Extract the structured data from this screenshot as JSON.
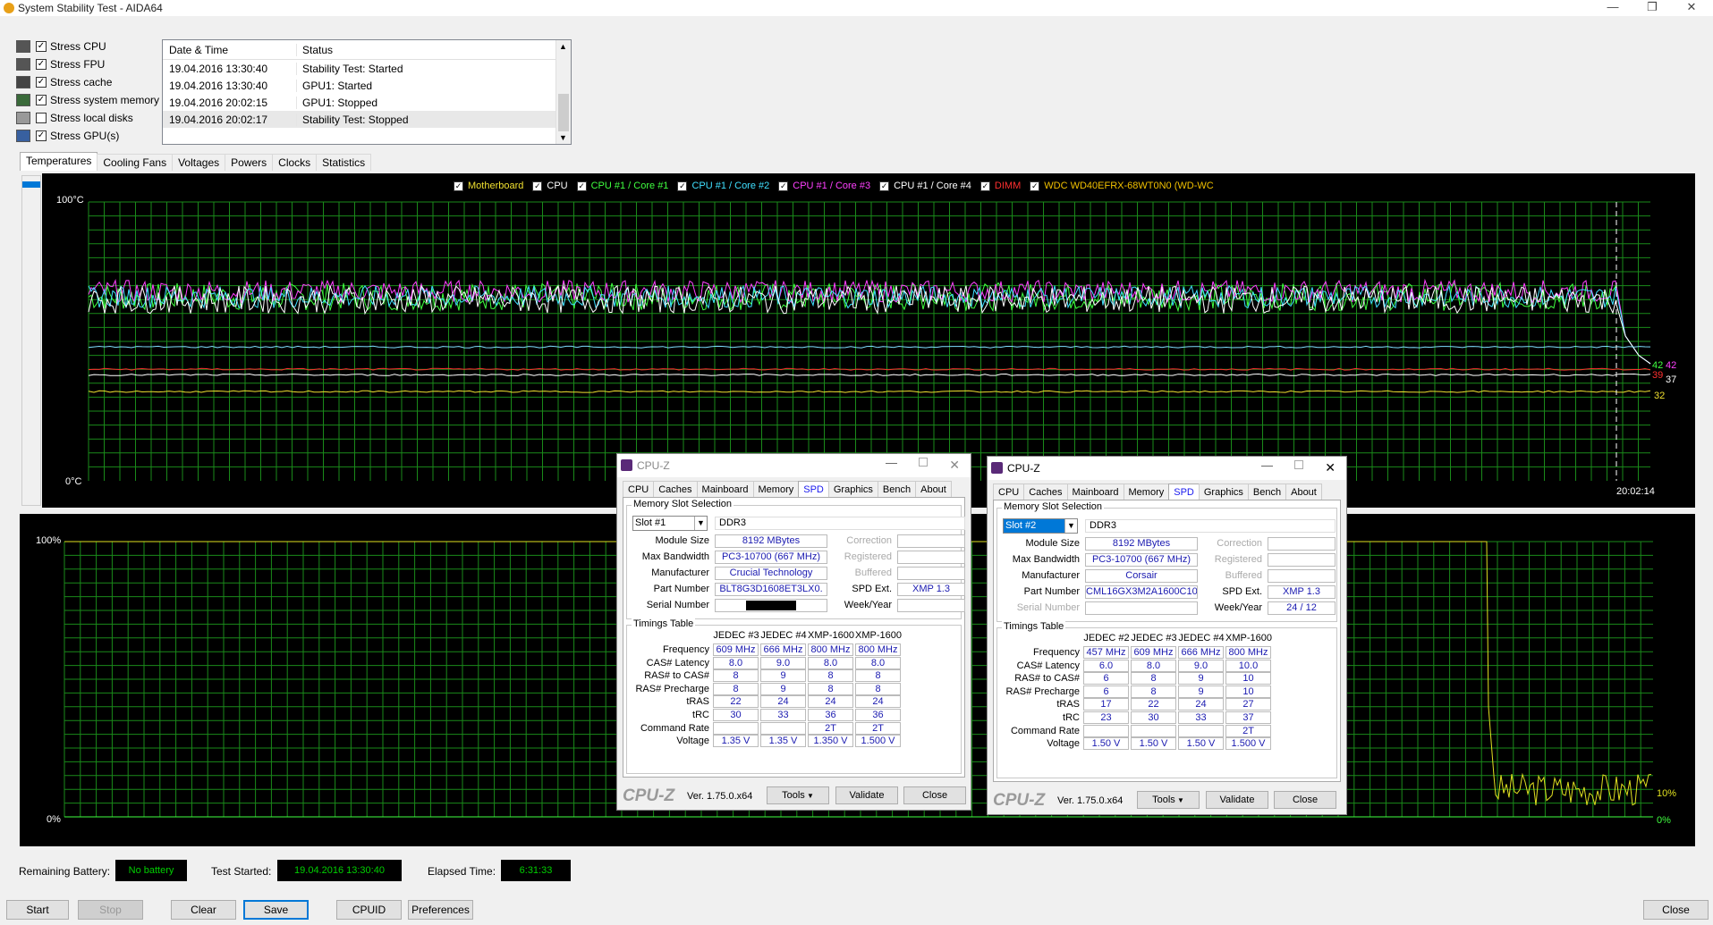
{
  "window": {
    "title": "System Stability Test - AIDA64",
    "minimize": "—",
    "restore": "❐",
    "close": "✕"
  },
  "stress_options": [
    {
      "label": "Stress CPU",
      "checked": true
    },
    {
      "label": "Stress FPU",
      "checked": true
    },
    {
      "label": "Stress cache",
      "checked": true
    },
    {
      "label": "Stress system memory",
      "checked": true
    },
    {
      "label": "Stress local disks",
      "checked": false
    },
    {
      "label": "Stress GPU(s)",
      "checked": true
    }
  ],
  "log": {
    "headers": [
      "Date & Time",
      "Status"
    ],
    "rows": [
      [
        "19.04.2016 13:30:40",
        "Stability Test: Started"
      ],
      [
        "19.04.2016 13:30:40",
        "GPU1: Started"
      ],
      [
        "19.04.2016 20:02:15",
        "GPU1: Stopped"
      ],
      [
        "19.04.2016 20:02:17",
        "Stability Test: Stopped"
      ]
    ]
  },
  "tabs": [
    "Temperatures",
    "Cooling Fans",
    "Voltages",
    "Powers",
    "Clocks",
    "Statistics"
  ],
  "active_tab": "Temperatures",
  "temp_graph": {
    "y_max": "100°C",
    "y_min": "0°C",
    "time": "20:02:14",
    "legend": [
      {
        "label": "Motherboard",
        "color": "#f0e030"
      },
      {
        "label": "CPU",
        "color": "#ffffff"
      },
      {
        "label": "CPU #1 / Core #1",
        "color": "#40ff40"
      },
      {
        "label": "CPU #1 / Core #2",
        "color": "#40e0ff"
      },
      {
        "label": "CPU #1 / Core #3",
        "color": "#ff40ff"
      },
      {
        "label": "CPU #1 / Core #4",
        "color": "#ffffff"
      },
      {
        "label": "DIMM",
        "color": "#ff3030"
      },
      {
        "label": "WDC WD40EFRX-68WT0N0 (WD-WC",
        "color": "#f0c000"
      }
    ],
    "end_values": [
      {
        "text": "42",
        "color": "#40ff40"
      },
      {
        "text": "42",
        "color": "#ff40ff"
      },
      {
        "text": "39",
        "color": "#ff3030"
      },
      {
        "text": "37",
        "color": "#ffffff"
      },
      {
        "text": "32",
        "color": "#f0e030"
      }
    ]
  },
  "usage_graph": {
    "y_max": "100%",
    "y_min": "0%",
    "end_value_cpu": "10%",
    "end_value_throttle": "0%"
  },
  "cpuz_windows": [
    {
      "title": "CPU-Z",
      "tabs": [
        "CPU",
        "Caches",
        "Mainboard",
        "Memory",
        "SPD",
        "Graphics",
        "Bench",
        "About"
      ],
      "active_tab": "SPD",
      "group_slot": "Memory Slot Selection",
      "slot": "Slot #1",
      "type": "DDR3",
      "module_size": "8192 MBytes",
      "max_bandwidth": "PC3-10700 (667 MHz)",
      "manufacturer": "Crucial Technology",
      "part_number": "BLT8G3D1608ET3LX0.",
      "serial_number": "",
      "spd_ext": "XMP 1.3",
      "week_year": "",
      "labels": {
        "module_size": "Module Size",
        "max_bandwidth": "Max Bandwidth",
        "manufacturer": "Manufacturer",
        "part_number": "Part Number",
        "serial_number": "Serial Number",
        "correction": "Correction",
        "registered": "Registered",
        "buffered": "Buffered",
        "spd_ext": "SPD Ext.",
        "week_year": "Week/Year"
      },
      "group_timings": "Timings Table",
      "timing_headers": [
        "JEDEC #3",
        "JEDEC #4",
        "XMP-1600",
        "XMP-1600"
      ],
      "timing_rows": [
        {
          "label": "Frequency",
          "values": [
            "609 MHz",
            "666 MHz",
            "800 MHz",
            "800 MHz"
          ]
        },
        {
          "label": "CAS# Latency",
          "values": [
            "8.0",
            "9.0",
            "8.0",
            "8.0"
          ]
        },
        {
          "label": "RAS# to CAS#",
          "values": [
            "8",
            "9",
            "8",
            "8"
          ]
        },
        {
          "label": "RAS# Precharge",
          "values": [
            "8",
            "9",
            "8",
            "8"
          ]
        },
        {
          "label": "tRAS",
          "values": [
            "22",
            "24",
            "24",
            "24"
          ]
        },
        {
          "label": "tRC",
          "values": [
            "30",
            "33",
            "36",
            "36"
          ]
        },
        {
          "label": "Command Rate",
          "values": [
            "",
            "",
            "2T",
            "2T"
          ]
        },
        {
          "label": "Voltage",
          "values": [
            "1.35 V",
            "1.35 V",
            "1.350 V",
            "1.500 V"
          ]
        }
      ],
      "brand": "CPU-Z",
      "version": "Ver. 1.75.0.x64",
      "tools": "Tools",
      "validate": "Validate",
      "close": "Close"
    },
    {
      "title": "CPU-Z",
      "tabs": [
        "CPU",
        "Caches",
        "Mainboard",
        "Memory",
        "SPD",
        "Graphics",
        "Bench",
        "About"
      ],
      "active_tab": "SPD",
      "group_slot": "Memory Slot Selection",
      "slot": "Slot #2",
      "type": "DDR3",
      "module_size": "8192 MBytes",
      "max_bandwidth": "PC3-10700 (667 MHz)",
      "manufacturer": "Corsair",
      "part_number": "CML16GX3M2A1600C10",
      "serial_number": "",
      "spd_ext": "XMP 1.3",
      "week_year": "24 / 12",
      "labels": {
        "module_size": "Module Size",
        "max_bandwidth": "Max Bandwidth",
        "manufacturer": "Manufacturer",
        "part_number": "Part Number",
        "serial_number": "Serial Number",
        "correction": "Correction",
        "registered": "Registered",
        "buffered": "Buffered",
        "spd_ext": "SPD Ext.",
        "week_year": "Week/Year"
      },
      "group_timings": "Timings Table",
      "timing_headers": [
        "JEDEC #2",
        "JEDEC #3",
        "JEDEC #4",
        "XMP-1600"
      ],
      "timing_rows": [
        {
          "label": "Frequency",
          "values": [
            "457 MHz",
            "609 MHz",
            "666 MHz",
            "800 MHz"
          ]
        },
        {
          "label": "CAS# Latency",
          "values": [
            "6.0",
            "8.0",
            "9.0",
            "10.0"
          ]
        },
        {
          "label": "RAS# to CAS#",
          "values": [
            "6",
            "8",
            "9",
            "10"
          ]
        },
        {
          "label": "RAS# Precharge",
          "values": [
            "6",
            "8",
            "9",
            "10"
          ]
        },
        {
          "label": "tRAS",
          "values": [
            "17",
            "22",
            "24",
            "27"
          ]
        },
        {
          "label": "tRC",
          "values": [
            "23",
            "30",
            "33",
            "37"
          ]
        },
        {
          "label": "Command Rate",
          "values": [
            "",
            "",
            "",
            "2T"
          ]
        },
        {
          "label": "Voltage",
          "values": [
            "1.50 V",
            "1.50 V",
            "1.50 V",
            "1.500 V"
          ]
        }
      ],
      "brand": "CPU-Z",
      "version": "Ver. 1.75.0.x64",
      "tools": "Tools",
      "validate": "Validate",
      "close": "Close"
    }
  ],
  "status": {
    "battery_label": "Remaining Battery:",
    "battery_value": "No battery",
    "started_label": "Test Started:",
    "started_value": "19.04.2016 13:30:40",
    "elapsed_label": "Elapsed Time:",
    "elapsed_value": "6:31:33"
  },
  "buttons": {
    "start": "Start",
    "stop": "Stop",
    "clear": "Clear",
    "save": "Save",
    "cpuid": "CPUID",
    "preferences": "Preferences",
    "close": "Close"
  }
}
